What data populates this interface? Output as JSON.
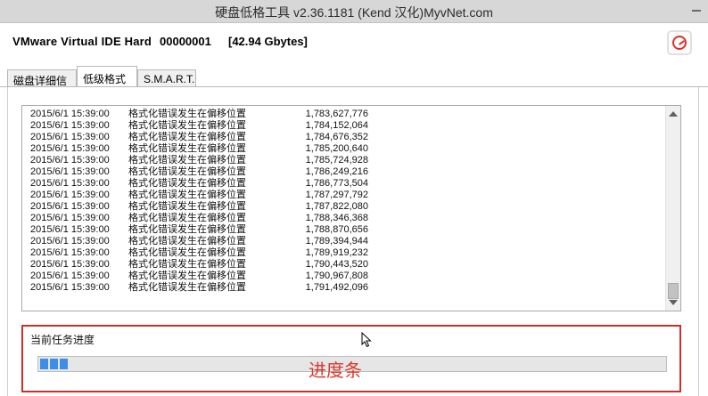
{
  "window": {
    "title": "硬盘低格工具 v2.36.1181 (Kend 汉化)MyvNet.com"
  },
  "device": {
    "name": "VMware Virtual IDE Hard",
    "serial": "00000001",
    "size": "[42.94 Gbytes]"
  },
  "tabs": [
    {
      "label": "磁盘详细信息",
      "active": false
    },
    {
      "label": "低级格式化",
      "active": true
    },
    {
      "label": "S.M.A.R.T.",
      "active": false
    }
  ],
  "log": {
    "rows": [
      {
        "time": "2015/6/1 15:39:00",
        "message": "格式化错误发生在偏移位置",
        "offset": "1,783,627,776"
      },
      {
        "time": "2015/6/1 15:39:00",
        "message": "格式化错误发生在偏移位置",
        "offset": "1,784,152,064"
      },
      {
        "time": "2015/6/1 15:39:00",
        "message": "格式化错误发生在偏移位置",
        "offset": "1,784,676,352"
      },
      {
        "time": "2015/6/1 15:39:00",
        "message": "格式化错误发生在偏移位置",
        "offset": "1,785,200,640"
      },
      {
        "time": "2015/6/1 15:39:00",
        "message": "格式化错误发生在偏移位置",
        "offset": "1,785,724,928"
      },
      {
        "time": "2015/6/1 15:39:00",
        "message": "格式化错误发生在偏移位置",
        "offset": "1,786,249,216"
      },
      {
        "time": "2015/6/1 15:39:00",
        "message": "格式化错误发生在偏移位置",
        "offset": "1,786,773,504"
      },
      {
        "time": "2015/6/1 15:39:00",
        "message": "格式化错误发生在偏移位置",
        "offset": "1,787,297,792"
      },
      {
        "time": "2015/6/1 15:39:00",
        "message": "格式化错误发生在偏移位置",
        "offset": "1,787,822,080"
      },
      {
        "time": "2015/6/1 15:39:00",
        "message": "格式化错误发生在偏移位置",
        "offset": "1,788,346,368"
      },
      {
        "time": "2015/6/1 15:39:00",
        "message": "格式化错误发生在偏移位置",
        "offset": "1,788,870,656"
      },
      {
        "time": "2015/6/1 15:39:00",
        "message": "格式化错误发生在偏移位置",
        "offset": "1,789,394,944"
      },
      {
        "time": "2015/6/1 15:39:00",
        "message": "格式化错误发生在偏移位置",
        "offset": "1,789,919,232"
      },
      {
        "time": "2015/6/1 15:39:00",
        "message": "格式化错误发生在偏移位置",
        "offset": "1,790,443,520"
      },
      {
        "time": "2015/6/1 15:39:00",
        "message": "格式化错误发生在偏移位置",
        "offset": "1,790,967,808"
      },
      {
        "time": "2015/6/1 15:39:00",
        "message": "格式化错误发生在偏移位置",
        "offset": "1,791,492,096"
      }
    ]
  },
  "progress": {
    "label": "当前任务进度",
    "percent": 5,
    "annotation": "进度条"
  },
  "colors": {
    "progress_fill": "#3c8ee6",
    "annotation_red": "#d93a30",
    "logo_red": "#d8322a"
  },
  "icons": [
    "minimize-icon",
    "app-logo-icon",
    "scroll-up-icon",
    "scroll-down-icon",
    "mouse-cursor-icon"
  ]
}
